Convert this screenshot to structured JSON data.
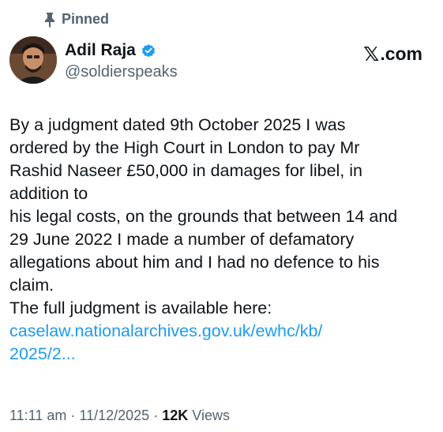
{
  "pinned": {
    "label": "Pinned",
    "icon": "pin-icon"
  },
  "author": {
    "display_name": "Adil Raja",
    "handle": "@soldierspeaks",
    "verified": true,
    "verified_color": "#1d9bf0"
  },
  "source": {
    "label": ".com",
    "logo_glyph": "𝕏"
  },
  "body": {
    "lines": [
      "By a judgment dated 9th October 2025 I was",
      "ordered by the High Court in London to pay Mr",
      "Rashid Naseer £50,000 in damages for libel, in",
      "addition to",
      "his legal costs, on the grounds that between 14 and",
      "29 June 2022 I made a number of defamatory",
      "allegations about him and I had no defence to his",
      "claim.",
      "The full judgment is available here:"
    ],
    "link_lines": [
      "caselaw.nationalarchives.gov.uk/ewhc/kb/",
      "2025/2..."
    ],
    "link_color": "#1d9bf0"
  },
  "meta": {
    "time": "11:11 am",
    "separator": "·",
    "date": "11/12/2025",
    "views_count": "12K",
    "views_label": "Views"
  }
}
